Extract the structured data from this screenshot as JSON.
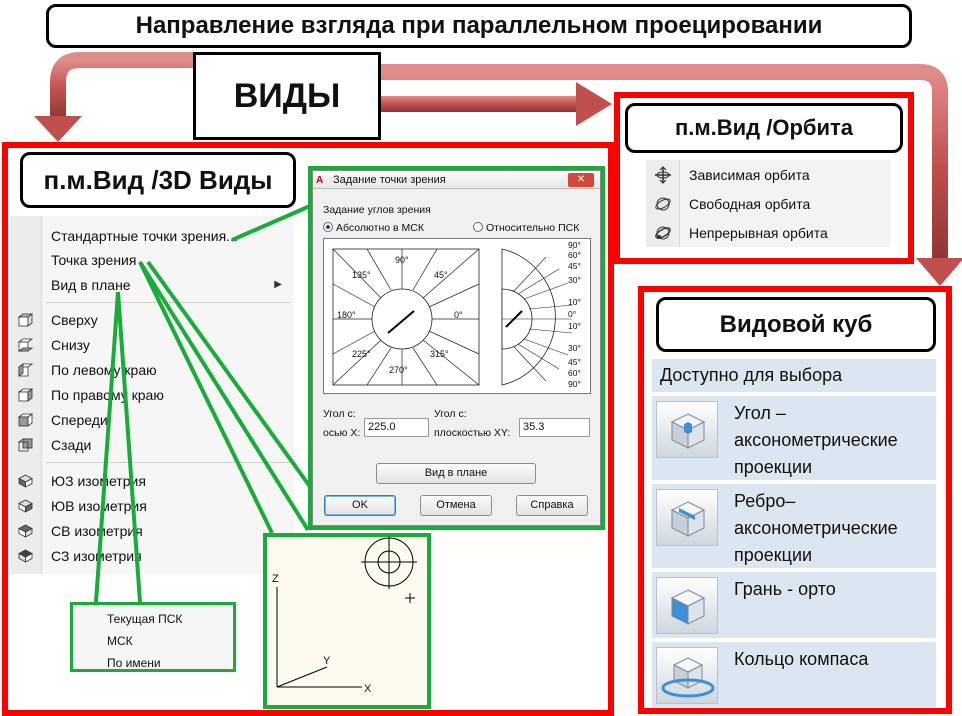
{
  "title": "Направление взгляда при параллельном проецировании",
  "vidy_label": "ВИДЫ",
  "panel_3d": {
    "label": "п.м.Вид /3D Виды",
    "menu": {
      "top_items": [
        "Стандартные точки зрения...",
        "Точка зрения",
        "Вид в плане"
      ],
      "ortho_items": [
        "Сверху",
        "Снизу",
        "По левому краю",
        "По правому краю",
        "Спереди",
        "Сзади"
      ],
      "iso_items": [
        "ЮЗ изометрия",
        "ЮВ изометрия",
        "СВ изометрия",
        "СЗ изометрия"
      ]
    },
    "submenu": [
      "Текущая ПСК",
      "МСК",
      "По имени"
    ]
  },
  "dialog": {
    "title": "Задание точки зрения",
    "group_label": "Задание углов зрения",
    "radio_abs": "Абсолютно в МСК",
    "radio_rel": "Относительно ПСК",
    "left_angles": [
      "90°",
      "135°",
      "45°",
      "180°",
      "0°",
      "225°",
      "315°",
      "270°"
    ],
    "right_angles": [
      "90°",
      "60°",
      "45°",
      "30°",
      "10°",
      "0°",
      "10°",
      "30°",
      "45°",
      "60°",
      "90°"
    ],
    "angle_x_label1": "Угол с:",
    "angle_x_label2": "осью X:",
    "angle_x_value": "225.0",
    "angle_xy_label1": "Угол с:",
    "angle_xy_label2": "плоскостью XY:",
    "angle_xy_value": "35.3",
    "plan_button": "Вид в плане",
    "ok_button": "OK",
    "cancel_button": "Отмена",
    "help_button": "Справка"
  },
  "canvas": {
    "z_label": "Z",
    "y_label": "Y",
    "x_label": "X"
  },
  "orbit_panel": {
    "label": "п.м.Вид /Орбита",
    "items": [
      "Зависимая орбита",
      "Свободная орбита",
      "Непрерывная орбита"
    ]
  },
  "viewcube_panel": {
    "label": "Видовой куб",
    "header": "Доступно для выбора",
    "rows": [
      [
        "Угол –",
        "аксонометрические",
        "проекции"
      ],
      [
        "Ребро–",
        "аксонометрические",
        "проекции"
      ],
      [
        "Грань - орто"
      ],
      [
        "Кольцо компаса"
      ]
    ]
  },
  "colors": {
    "red_frame": "#ff0000",
    "green_connector": "#1aab3a",
    "arrow_red": "#c0504d",
    "viewcube_bg": "#dce6f1"
  }
}
